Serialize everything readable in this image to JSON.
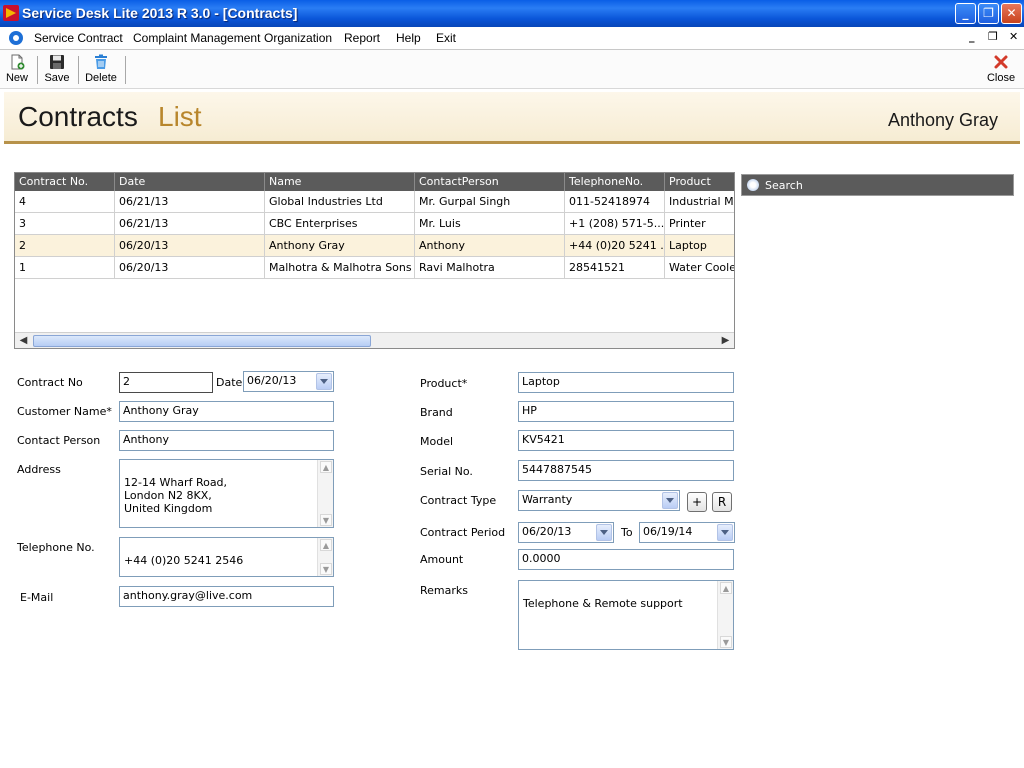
{
  "window": {
    "title": "Service Desk Lite 2013 R 3.0 - [Contracts]"
  },
  "menu": [
    "Service Contract",
    "Complaint Management",
    "Organization",
    "Report",
    "Help",
    "Exit"
  ],
  "toolbar": {
    "new": "New",
    "save": "Save",
    "delete": "Delete",
    "close": "Close"
  },
  "banner": {
    "title_part1": "Contracts",
    "title_part2": "List",
    "user": "Anthony Gray"
  },
  "grid": {
    "columns": [
      "Contract No.",
      "Date",
      "Name",
      "ContactPerson",
      "TelephoneNo.",
      "Product"
    ],
    "rows": [
      [
        "4",
        "06/21/13",
        "Global Industries Ltd",
        "Mr. Gurpal Singh",
        "011-52418974",
        "Industrial Mac"
      ],
      [
        "3",
        "06/21/13",
        "CBC Enterprises",
        "Mr. Luis",
        "+1 (208) 571-5...",
        "Printer"
      ],
      [
        "2",
        "06/20/13",
        "Anthony Gray",
        "Anthony",
        "+44 (0)20 5241 ...",
        "Laptop"
      ],
      [
        "1",
        "06/20/13",
        "Malhotra & Malhotra Sons",
        "Ravi Malhotra",
        "28541521",
        "Water Cooler"
      ]
    ],
    "selected_row": 2
  },
  "search": {
    "label": "Search"
  },
  "form": {
    "contract_no": {
      "label": "Contract No",
      "value": "2"
    },
    "date": {
      "label": "Date",
      "value": "06/20/13"
    },
    "customer_name": {
      "label": "Customer Name*",
      "value": "Anthony Gray"
    },
    "contact_person": {
      "label": "Contact Person",
      "value": "Anthony"
    },
    "address": {
      "label": "Address",
      "value": "12-14 Wharf Road,\nLondon N2 8KX,\nUnited Kingdom"
    },
    "telephone": {
      "label": "Telephone No.",
      "value": "+44 (0)20 5241 2546"
    },
    "email": {
      "label": "E-Mail",
      "value": "anthony.gray@live.com"
    },
    "product": {
      "label": "Product*",
      "value": "Laptop"
    },
    "brand": {
      "label": "Brand",
      "value": "HP"
    },
    "model": {
      "label": "Model",
      "value": "KV5421"
    },
    "serial_no": {
      "label": "Serial No.",
      "value": "5447887545"
    },
    "contract_type": {
      "label": "Contract Type",
      "value": "Warranty",
      "add_label": "+",
      "refresh_label": "R"
    },
    "contract_period": {
      "label": "Contract Period",
      "from": "06/20/13",
      "to_label": "To",
      "to": "06/19/14"
    },
    "amount": {
      "label": "Amount",
      "value": "0.0000"
    },
    "remarks": {
      "label": "Remarks",
      "value": "Telephone & Remote support"
    }
  },
  "colors": {
    "titlebar": "#0a55d8",
    "grid_header": "#5b5b5b",
    "banner_accent": "#b8862c",
    "selected_row": "#fbf2dc"
  },
  "icons": [
    "app-icon",
    "menu-icon",
    "new-icon",
    "save-icon",
    "delete-icon",
    "close-icon",
    "search-icon"
  ]
}
